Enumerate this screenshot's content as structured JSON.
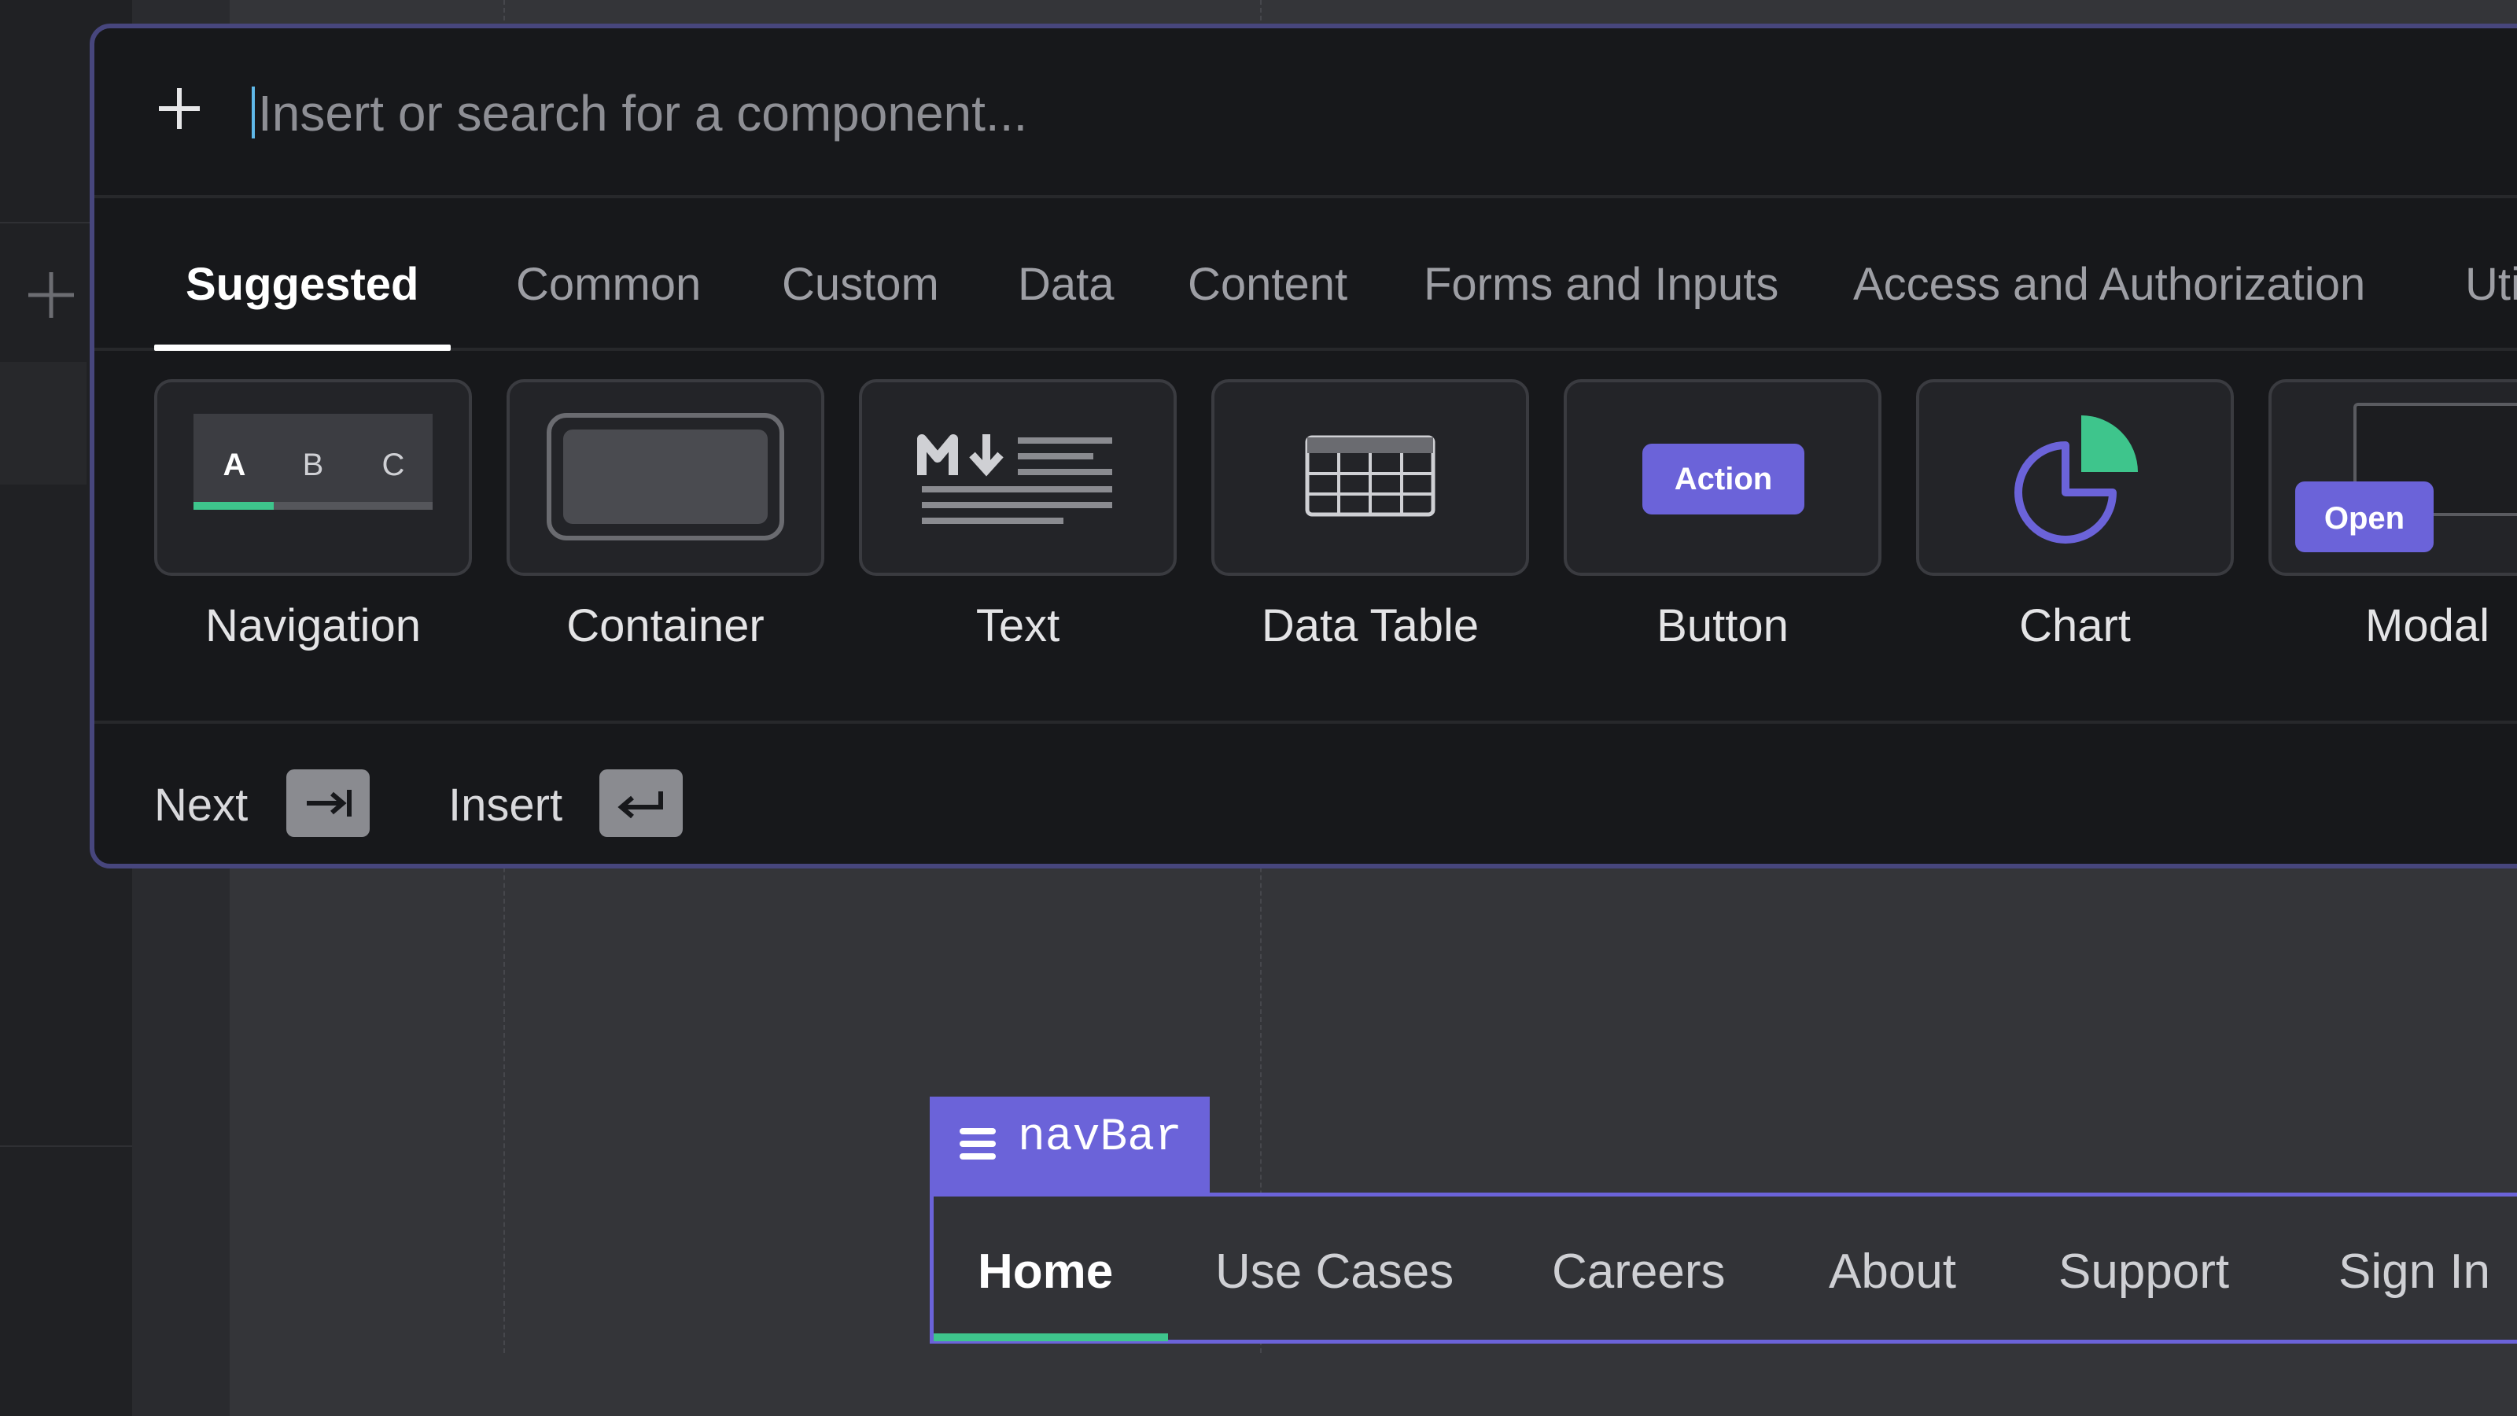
{
  "search": {
    "placeholder": "Insert or search for a component..."
  },
  "tabs": [
    {
      "label": "Suggested",
      "active": true
    },
    {
      "label": "Common"
    },
    {
      "label": "Custom"
    },
    {
      "label": "Data"
    },
    {
      "label": "Content"
    },
    {
      "label": "Forms and Inputs"
    },
    {
      "label": "Access and Authorization"
    },
    {
      "label": "Utili"
    }
  ],
  "components": [
    {
      "label": "Navigation",
      "icon": "navigation-tabs-icon",
      "preview": {
        "tabs": [
          "A",
          "B",
          "C"
        ]
      }
    },
    {
      "label": "Container",
      "icon": "container-icon"
    },
    {
      "label": "Text",
      "icon": "markdown-text-icon"
    },
    {
      "label": "Data Table",
      "icon": "table-icon"
    },
    {
      "label": "Button",
      "icon": "action-button-icon",
      "preview": {
        "text": "Action"
      }
    },
    {
      "label": "Chart",
      "icon": "pie-chart-icon"
    },
    {
      "label": "Modal",
      "icon": "modal-icon",
      "preview": {
        "text": "Open"
      }
    }
  ],
  "footer": {
    "next_label": "Next",
    "next_key_icon": "tab-key-icon",
    "insert_label": "Insert",
    "insert_key_icon": "enter-key-icon"
  },
  "navbar": {
    "tag": "navBar",
    "items": [
      "Home",
      "Use Cases",
      "Careers",
      "About",
      "Support",
      "Sign In"
    ],
    "active_index": 0
  },
  "colors": {
    "accent": "#6b63d9",
    "active_underline": "#3ec58c",
    "palette_bg": "#17181b",
    "canvas_bg": "#343539"
  }
}
